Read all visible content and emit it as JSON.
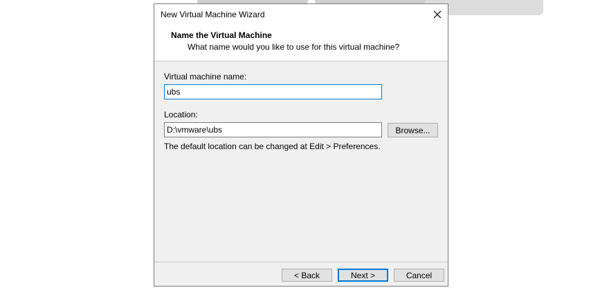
{
  "dialog": {
    "title": "New Virtual Machine Wizard",
    "header_title": "Name the Virtual Machine",
    "header_subtitle": "What name would you like to use for this virtual machine?"
  },
  "form": {
    "name_label": "Virtual machine name:",
    "name_value": "ubs",
    "location_label": "Location:",
    "location_value": "D:\\vmware\\ubs",
    "browse_label": "Browse...",
    "hint": "The default location can be changed at Edit > Preferences."
  },
  "footer": {
    "back_label": "< Back",
    "next_label": "Next >",
    "cancel_label": "Cancel"
  },
  "icons": {
    "close": "close-icon"
  },
  "colors": {
    "focus_accent": "#0078d7",
    "dialog_bg": "#f0f0f0"
  }
}
